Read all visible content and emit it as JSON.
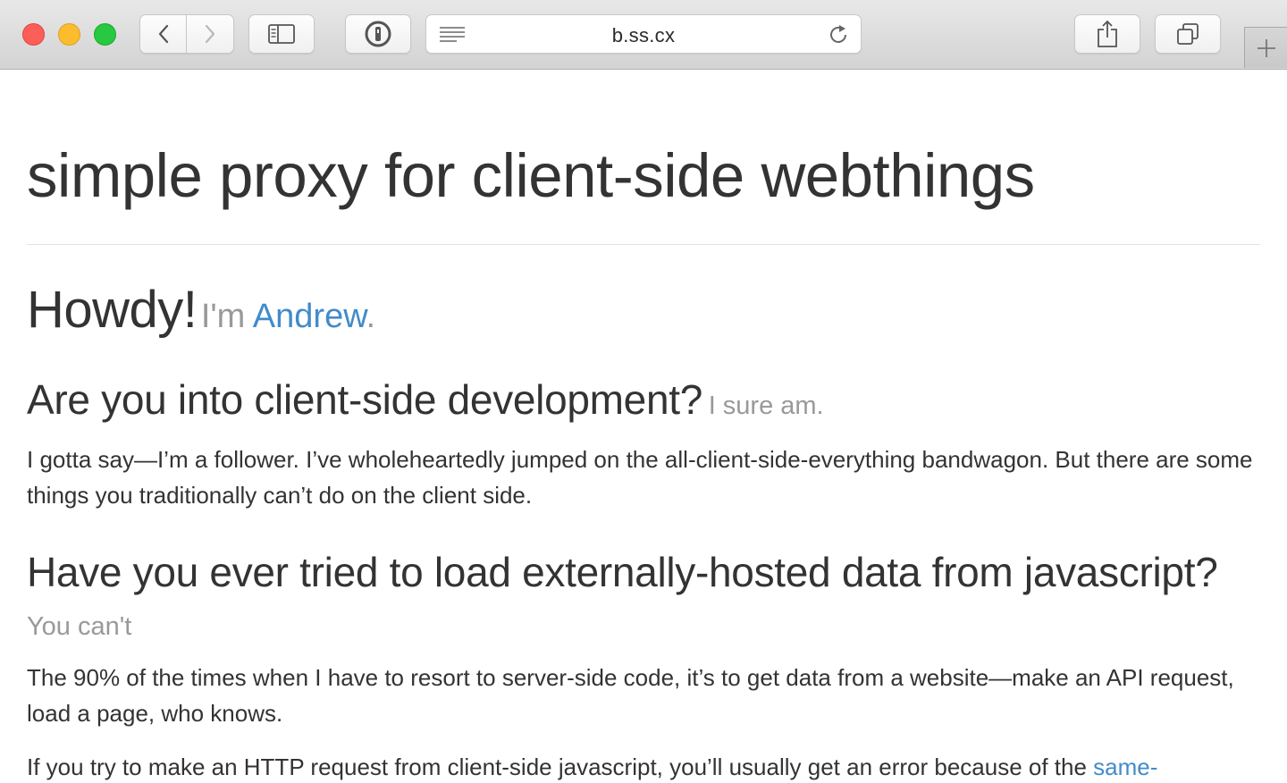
{
  "browser": {
    "url": "b.ss.cx",
    "icons": {
      "close": "close-button",
      "minimize": "minimize-button",
      "zoom": "zoom-button",
      "back": "chevron-left-icon",
      "forward": "chevron-right-icon",
      "sidebar": "sidebar-icon",
      "password_manager": "1password-icon",
      "reader": "reader-icon",
      "reload": "reload-icon",
      "share": "share-icon",
      "tabs": "tab-overview-icon",
      "new_tab": "plus-icon"
    },
    "colors": {
      "close": "#fc5f57",
      "minimize": "#fdbc2e",
      "zoom": "#28c840"
    }
  },
  "page": {
    "title": "simple proxy for client-side webthings",
    "howdy": {
      "heading": "Howdy!",
      "prefix": "I'm ",
      "name_link": "Andrew",
      "suffix": "."
    },
    "section_dev": {
      "heading": "Are you into client-side development?",
      "aside": "I sure am."
    },
    "para1": "I gotta say—I’m a follower. I’ve wholeheartedly jumped on the all-client-side-everything bandwagon. But there are some things you traditionally can’t do on the client side.",
    "section_js": {
      "heading": "Have you ever tried to load externally-hosted data from javascript?",
      "aside": "You can't"
    },
    "para2": "The 90% of the times when I have to resort to server-side code, it’s to get data from a website—make an API request, load a page, who knows.",
    "para3": {
      "text": "If you try to make an HTTP request from client-side javascript, you’ll usually get an error because of the ",
      "link": "same-"
    },
    "colors": {
      "link": "#428bca",
      "muted": "#999999",
      "text": "#333333"
    }
  }
}
